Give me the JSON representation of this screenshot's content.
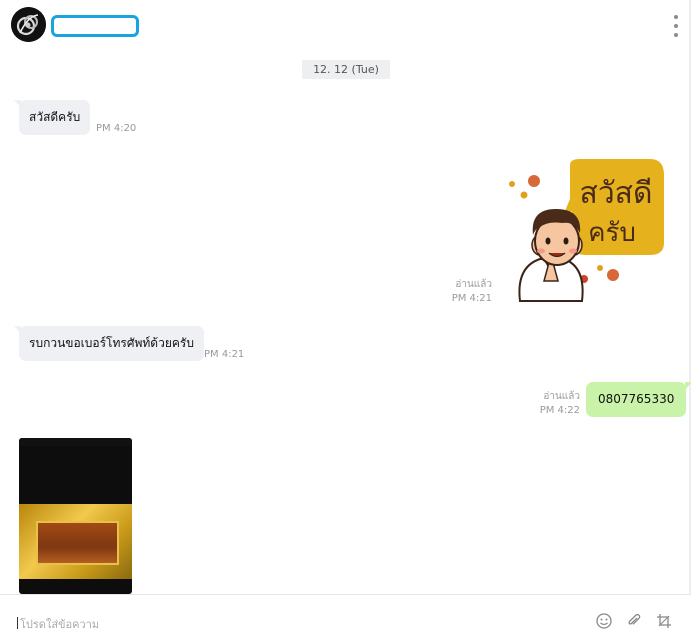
{
  "header": {
    "avatar": "avatar-logo",
    "contact_name": "",
    "menu_icon": "kebab-menu-icon"
  },
  "date_separator": "12. 12 (Tue)",
  "messages": [
    {
      "id": "m1",
      "direction": "incoming",
      "type": "text",
      "text": "สวัสดีครับ",
      "time": "PM 4:20"
    },
    {
      "id": "m2",
      "direction": "outgoing",
      "type": "sticker",
      "sticker_text_line1": "สวัสดี",
      "sticker_text_line2": "ครับ",
      "read": "อ่านแล้ว",
      "time": "PM 4:21"
    },
    {
      "id": "m3",
      "direction": "incoming",
      "type": "text",
      "text": "รบกวนขอเบอร์โทรศัพท์ด้วยครับ",
      "time": "PM 4:21"
    },
    {
      "id": "m4",
      "direction": "outgoing",
      "type": "text",
      "text": "0807765330",
      "read": "อ่านแล้ว",
      "time": "PM 4:22"
    },
    {
      "id": "m5",
      "direction": "incoming",
      "type": "image",
      "alt": "photo of ornate gold frame"
    }
  ],
  "composer": {
    "placeholder": "โปรดใส่ข้อความ",
    "icons": [
      "emoji-icon",
      "attach-icon",
      "crop-icon"
    ]
  },
  "colors": {
    "incoming_bubble": "#eef0f3",
    "outgoing_bubble": "#c8f3a8",
    "highlight_box": "#1aa3dd"
  }
}
